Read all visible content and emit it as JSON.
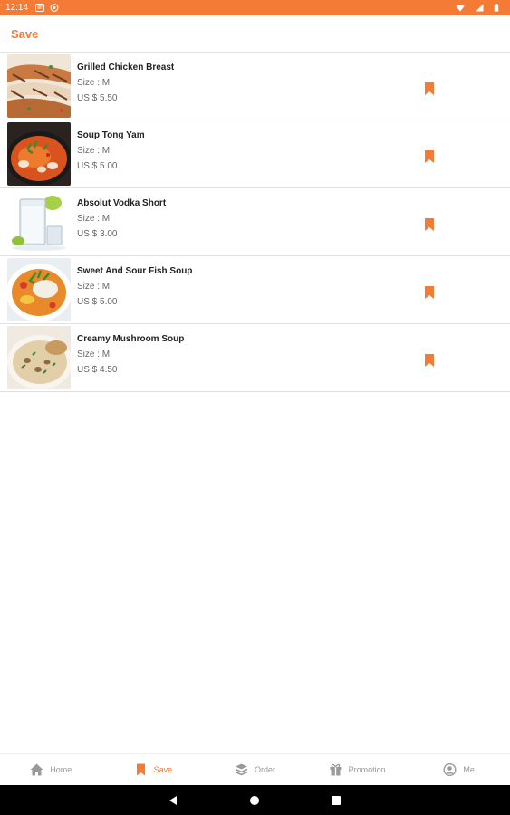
{
  "status_bar": {
    "time": "12:14"
  },
  "header": {
    "title": "Save"
  },
  "items": [
    {
      "name": "Grilled Chicken Breast",
      "size": "Size :  M",
      "price": "US $ 5.50"
    },
    {
      "name": "Soup Tong Yam",
      "size": "Size :  M",
      "price": "US $ 5.00"
    },
    {
      "name": "Absolut Vodka Short",
      "size": "Size :  M",
      "price": "US $ 3.00"
    },
    {
      "name": "Sweet And Sour Fish Soup",
      "size": "Size :  M",
      "price": "US $ 5.00"
    },
    {
      "name": "Creamy Mushroom Soup",
      "size": "Size :  M",
      "price": "US $ 4.50"
    }
  ],
  "bottom_nav": [
    {
      "label": "Home",
      "icon": "home-icon"
    },
    {
      "label": "Save",
      "icon": "bookmark-icon",
      "active": true
    },
    {
      "label": "Order",
      "icon": "layers-icon"
    },
    {
      "label": "Promotion",
      "icon": "gift-icon"
    },
    {
      "label": "Me",
      "icon": "user-icon"
    }
  ],
  "colors": {
    "accent": "#f47b35",
    "muted": "#999999"
  }
}
